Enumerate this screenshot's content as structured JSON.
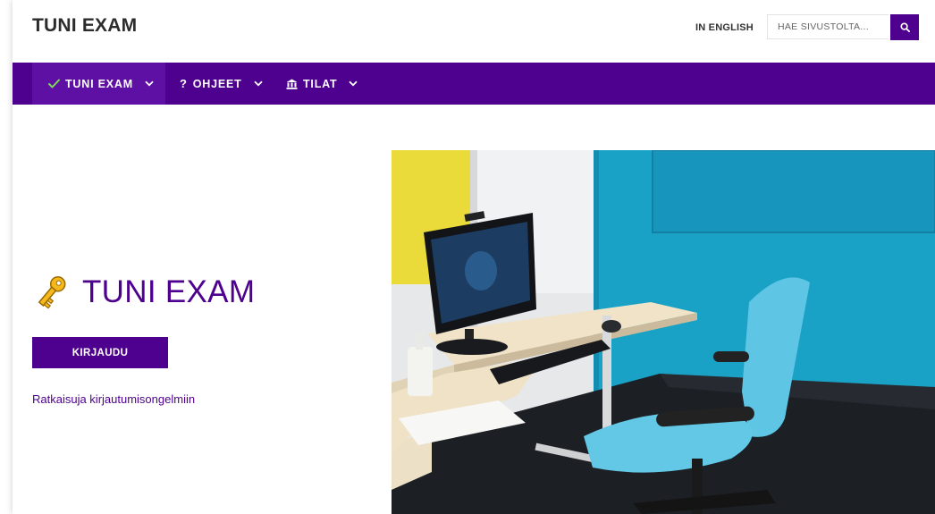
{
  "header": {
    "site_title": "TUNI EXAM",
    "language_link": "IN ENGLISH",
    "search": {
      "placeholder": "HAE SIVUSTOLTA...",
      "value": "",
      "button_icon": "search-icon"
    }
  },
  "nav": {
    "items": [
      {
        "label": "TUNI EXAM",
        "icon": "check-icon",
        "active": true
      },
      {
        "label": "OHJEET",
        "icon": "question-icon",
        "active": false
      },
      {
        "label": "TILAT",
        "icon": "building-icon",
        "active": false
      }
    ]
  },
  "hero": {
    "icon": "key-icon",
    "title": "TUNI EXAM",
    "login_button": "KIRJAUDU",
    "help_link": "Ratkaisuja kirjautumisongelmiin"
  },
  "colors": {
    "brand_purple": "#4e008e",
    "nav_active": "#5f10a4",
    "key_gold": "#f4b91c"
  }
}
